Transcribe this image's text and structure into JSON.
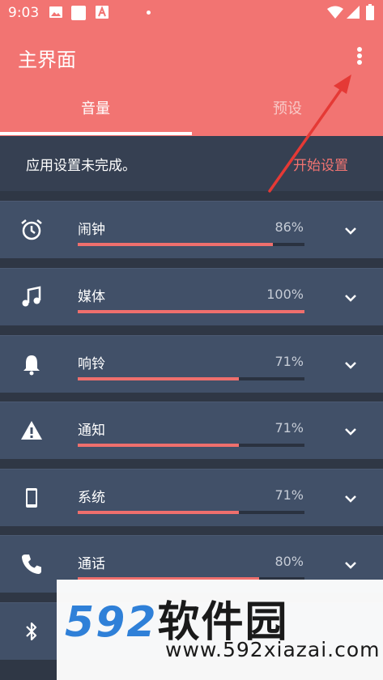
{
  "status_bar": {
    "time": "9:03"
  },
  "app_bar": {
    "title": "主界面"
  },
  "tabs": [
    {
      "label": "音量",
      "active": true
    },
    {
      "label": "预设",
      "active": false
    }
  ],
  "banner": {
    "message": "应用设置未完成。",
    "action_label": "开始设置"
  },
  "volume_items": [
    {
      "label": "闹钟",
      "percent_text": "86%",
      "level": 0.86,
      "icon": "alarm-icon"
    },
    {
      "label": "媒体",
      "percent_text": "100%",
      "level": 1.0,
      "icon": "music-note-icon"
    },
    {
      "label": "响铃",
      "percent_text": "71%",
      "level": 0.71,
      "icon": "bell-icon"
    },
    {
      "label": "通知",
      "percent_text": "71%",
      "level": 0.71,
      "icon": "warning-icon"
    },
    {
      "label": "系统",
      "percent_text": "71%",
      "level": 0.71,
      "icon": "phone-device-icon"
    },
    {
      "label": "通话",
      "percent_text": "80%",
      "level": 0.8,
      "icon": "phone-call-icon"
    },
    {
      "label": "",
      "percent_text": "",
      "level": 0.0,
      "icon": "bluetooth-icon"
    }
  ],
  "watermark": {
    "brand_number": "592",
    "brand_text": "软件园",
    "url": "www.592xiazai.com"
  },
  "colors": {
    "accent": "#f27472",
    "background": "#2f3745",
    "card": "#415068",
    "banner": "#364052",
    "slider_fill": "#ef6f6d",
    "arrow": "#e53935"
  }
}
